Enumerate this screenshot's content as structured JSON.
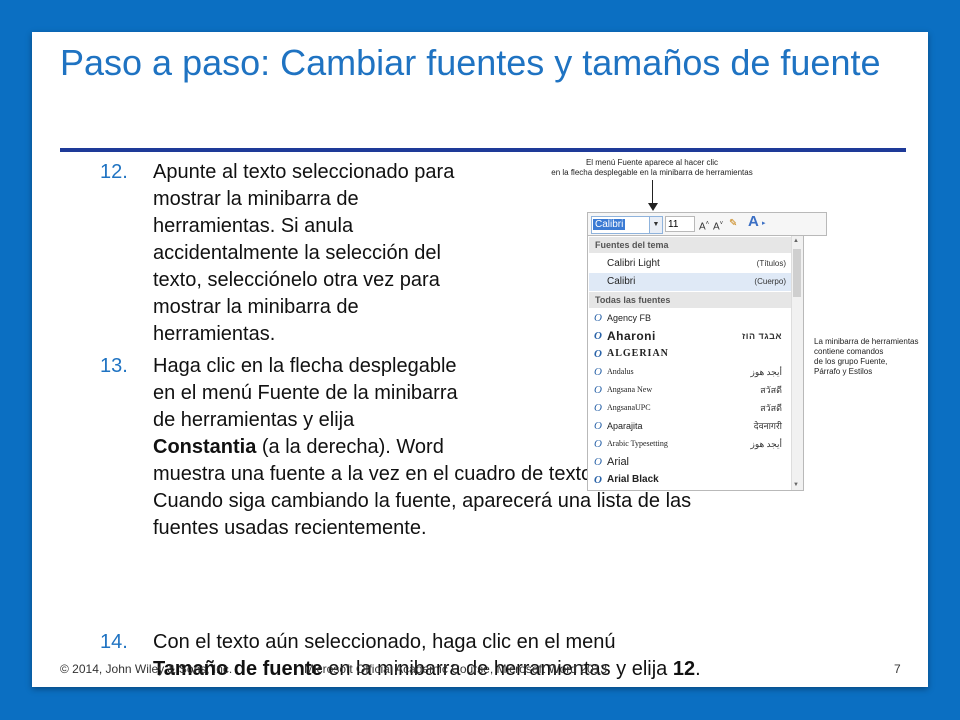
{
  "title": "Paso a paso: Cambiar fuentes y tamaños de fuente",
  "steps": [
    {
      "number": "12.",
      "lines": [
        "Apunte al texto seleccionado para",
        "mostrar la minibarra de",
        "herramientas. Si anula",
        "accidentalmente la selección del",
        "texto, selecciónelo otra vez para",
        "mostrar la minibarra de",
        "herramientas."
      ]
    },
    {
      "number": "13.",
      "lines": [
        "Haga clic en la flecha desplegable",
        "en el menú Fuente de la minibarra",
        "de herramientas y elija",
        "muestra una fuente a la vez en el cuadro de texto Fuente.",
        "Cuando siga cambiando la fuente, aparecerá una lista de las",
        "fuentes usadas recientemente."
      ],
      "bold_word": "Constantia",
      "bold_suffix": " (a la derecha). Word"
    },
    {
      "number": "14.",
      "line1": "Con el texto aún seleccionado, haga clic en el menú",
      "bold_word": "Tamaño de fuente",
      "mid": " en la minibarra de herramientas y elija ",
      "bold_end": "12",
      "end": "."
    }
  ],
  "screenshot": {
    "caption_top_line1": "El menú Fuente aparece al hacer clic",
    "caption_top_line2": "en la flecha desplegable en la minibarra de herramientas",
    "caption_side_line1": "La minibarra de herramientas",
    "caption_side_line2": "contiene comandos",
    "caption_side_line3": "de los grupo Fuente,",
    "caption_side_line4": "Párrafo y Estilos",
    "font_value": "Calibri",
    "size_value": "11",
    "section_theme": "Fuentes del tema",
    "section_all": "Todas las fuentes",
    "theme_fonts": [
      {
        "name": "Calibri Light",
        "tag": "(Títulos)"
      },
      {
        "name": "Calibri",
        "tag": "(Cuerpo)"
      }
    ],
    "all_fonts": [
      {
        "name": "Agency FB",
        "sample": ""
      },
      {
        "name": "Aharoni",
        "sample": "אבגד הוז"
      },
      {
        "name": "ALGERIAN",
        "sample": ""
      },
      {
        "name": "Andalus",
        "sample": "أيجد هوز"
      },
      {
        "name": "Angsana New",
        "sample": "สวัสดี"
      },
      {
        "name": "AngsanaUPC",
        "sample": "สวัสดี"
      },
      {
        "name": "Aparajita",
        "sample": "देवनागरी"
      },
      {
        "name": "Arabic Typesetting",
        "sample": "أيجد هوز"
      },
      {
        "name": "Arial",
        "sample": ""
      },
      {
        "name": "Arial Black",
        "sample": ""
      }
    ]
  },
  "footer": {
    "copyright": "© 2014, John Wiley & Sons, Inc.",
    "course": "Microsoft Official Academic Course, Microsoft Word 2013",
    "page": "7"
  }
}
